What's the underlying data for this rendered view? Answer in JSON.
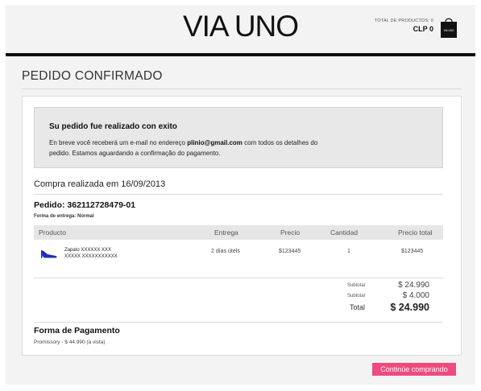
{
  "header": {
    "logo": "VIA UNO",
    "cart_label": "TOTAL DE PRODUCTOS: 0",
    "cart_total": "CLP 0",
    "bag_brand": "VIA UNO"
  },
  "page": {
    "title": "PEDIDO CONFIRMADO"
  },
  "notice": {
    "title": "Su pedido fue realizado con exito",
    "body_prefix": "En breve você receberá um e-mail no endereço ",
    "email": "plinio@gmail.com",
    "body_suffix": " com todos os detalhes do pedido. Estamos aguardando a confirmação do pagamento."
  },
  "purchase": {
    "date_text": "Compra realizada em 16/09/2013"
  },
  "order": {
    "id_text": "Pedido: 362112728479-01",
    "delivery_text": "Forma de entrega: Normal",
    "columns": [
      "Producto",
      "Entrega",
      "Precio",
      "Cantidad",
      "Precio total"
    ],
    "items": [
      {
        "name_line1": "Zapato XXXXXX XXX",
        "name_line2": "XXXXX XXXXXXXXXXX",
        "icon": "shoe-icon",
        "delivery": "2 días útels",
        "price": "$123445",
        "quantity": "1",
        "total": "$123445"
      }
    ]
  },
  "totals": [
    {
      "label": "Subtotal",
      "value": "$ 24.990"
    },
    {
      "label": "Subtotal",
      "value": "$ 4.000"
    },
    {
      "label": "Total",
      "value": "$ 24.990"
    }
  ],
  "payment": {
    "title": "Forma de Pagamento",
    "detail": "Promissory - $ 44.990 (à vista)"
  },
  "actions": {
    "continue_label": "Continúe comprando"
  },
  "colors": {
    "accent": "#ef4a7e",
    "header_bar": "#111111",
    "notice_bg": "#e8e8e8",
    "table_header_bg": "#e6e6e6"
  }
}
